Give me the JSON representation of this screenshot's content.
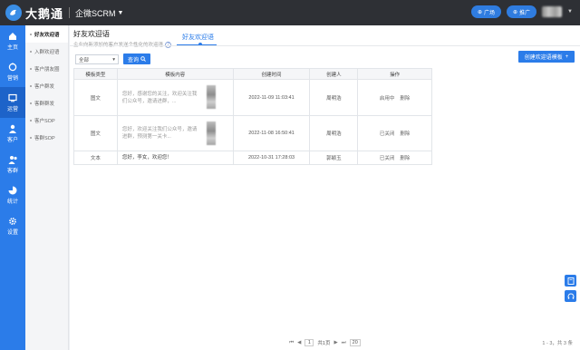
{
  "brand": {
    "name": "大鹅通",
    "product": "企微SCRM"
  },
  "topbar": {
    "broadcast_label": "广场",
    "promote_label": "推广",
    "accent": "#2f7ce0"
  },
  "rail": {
    "items": [
      {
        "label": "主页",
        "icon": "home-icon"
      },
      {
        "label": "营销",
        "icon": "marketing-icon"
      },
      {
        "label": "运营",
        "icon": "operation-icon"
      },
      {
        "label": "客户",
        "icon": "customer-icon"
      },
      {
        "label": "客群",
        "icon": "group-icon"
      },
      {
        "label": "统计",
        "icon": "chart-icon"
      },
      {
        "label": "设置",
        "icon": "gear-icon"
      }
    ],
    "active_index": 2,
    "color": "#2b7ce9"
  },
  "subnav": {
    "items": [
      {
        "label": "好友欢迎语",
        "active": true
      },
      {
        "label": "入群欢迎语",
        "active": false
      },
      {
        "label": "客户朋友圈",
        "active": false
      },
      {
        "label": "客户群发",
        "active": false
      },
      {
        "label": "客群群发",
        "active": false
      },
      {
        "label": "客户SOP",
        "active": false
      },
      {
        "label": "客群SOP",
        "active": false
      }
    ]
  },
  "page": {
    "title": "好友欢迎语",
    "subtitle": "企业向新添加的客户发送个性化的欢迎语",
    "tab": "好友欢迎语"
  },
  "toolbar": {
    "filter_value": "全部",
    "query_label": "查询",
    "create_label": "创建欢迎语模板"
  },
  "table": {
    "headers": [
      "模板类型",
      "模板内容",
      "创建时间",
      "创建人",
      "操作"
    ],
    "rows": [
      {
        "type": "图文",
        "content": "您好，感谢您的关注，欢迎关注我们公众号，邀请进群，...",
        "has_image": true,
        "created": "2022-11-09 11:03:41",
        "creator": "周明浩",
        "status": "启用中",
        "delete": "删除"
      },
      {
        "type": "图文",
        "content": "您好，欢迎关注我们公众号，邀请进群，预测第一关卡...",
        "has_image": true,
        "created": "2022-11-08 16:50:41",
        "creator": "周明浩",
        "status": "已关闭",
        "delete": "删除"
      },
      {
        "type": "文本",
        "content": "您好，李女，欢迎您！",
        "has_image": false,
        "created": "2022-10-31 17:28:03",
        "creator": "郭颖玉",
        "status": "已关闭",
        "delete": "删除"
      }
    ]
  },
  "pager": {
    "first": "⏮",
    "prev": "◀",
    "page": "1",
    "total_text": "共1页",
    "next": "▶",
    "last": "⏭",
    "page_size": "20",
    "range": "1 - 3，共 3 条"
  }
}
